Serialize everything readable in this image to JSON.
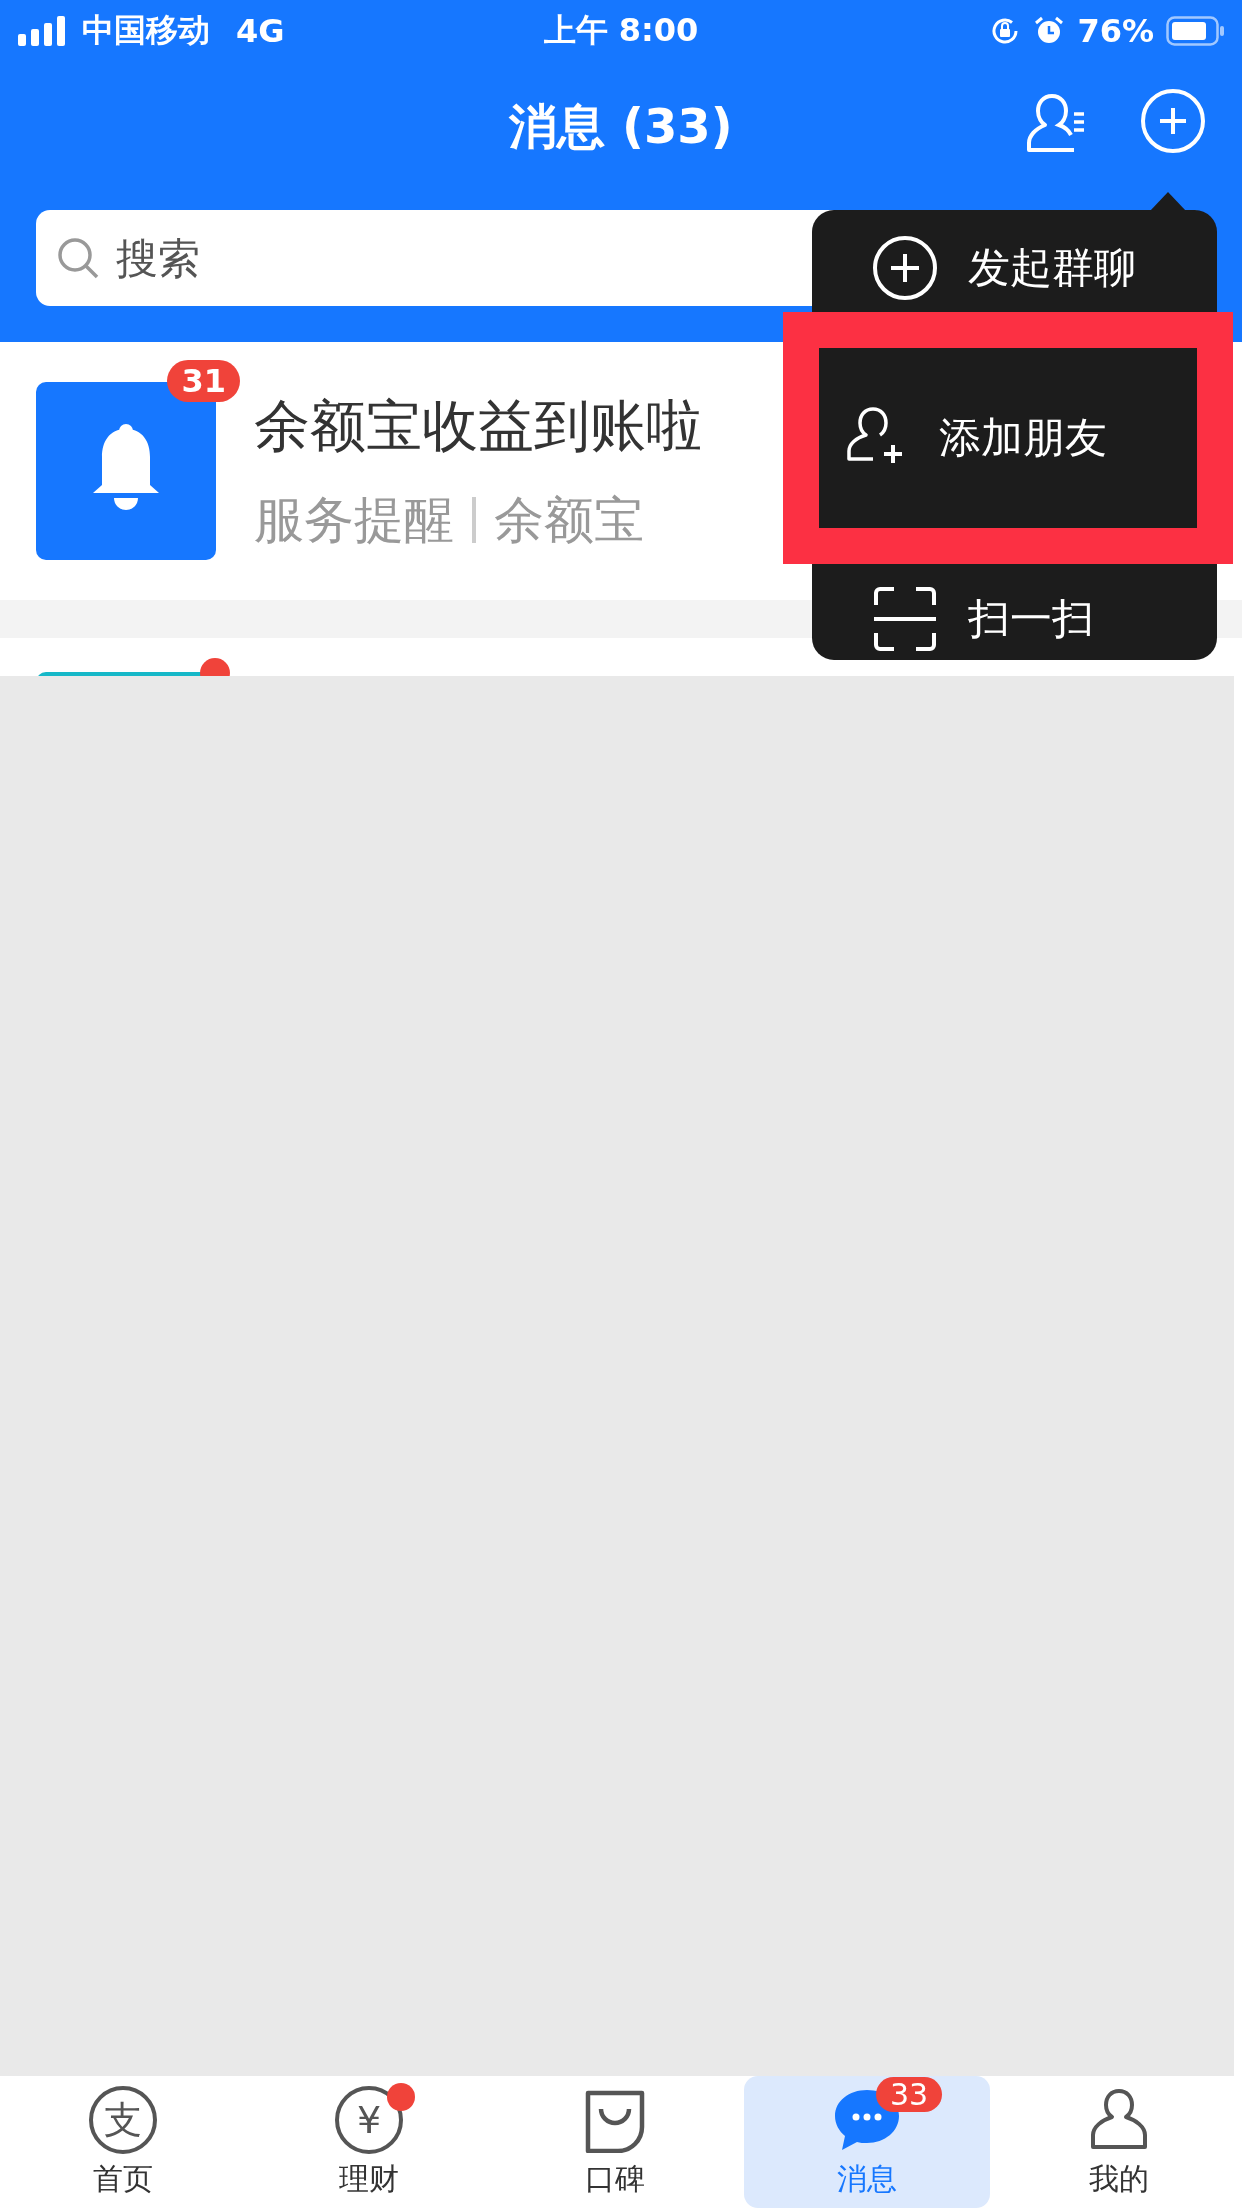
{
  "status_bar": {
    "carrier": "中国移动",
    "network": "4G",
    "time": "上午 8:00",
    "battery": "76%"
  },
  "header": {
    "title": "消息 (33)"
  },
  "search": {
    "placeholder": "搜索"
  },
  "messages": [
    {
      "kind": "notice",
      "badge": "31",
      "title": "余额宝收益到账啦",
      "category": "服务提醒",
      "source": "余额宝"
    },
    {
      "kind": "partial",
      "dot": true
    }
  ],
  "menu": {
    "items": [
      {
        "kind": "group",
        "label": "发起群聊",
        "highlighted": false
      },
      {
        "kind": "add",
        "label": "添加朋友",
        "highlighted": true
      },
      {
        "kind": "scan",
        "label": "扫一扫",
        "highlighted": false
      }
    ]
  },
  "tabs": [
    {
      "kind": "home",
      "glyph": "支",
      "label": "首页",
      "selected": false,
      "dot": false
    },
    {
      "kind": "finance",
      "glyph": "¥",
      "label": "理财",
      "selected": false,
      "dot": true
    },
    {
      "kind": "koubei",
      "label": "口碑",
      "selected": false,
      "dot": false
    },
    {
      "kind": "chat",
      "label": "消息",
      "selected": true,
      "dot": false,
      "badge": "33"
    },
    {
      "kind": "me",
      "label": "我的",
      "selected": false,
      "dot": false
    }
  ]
}
